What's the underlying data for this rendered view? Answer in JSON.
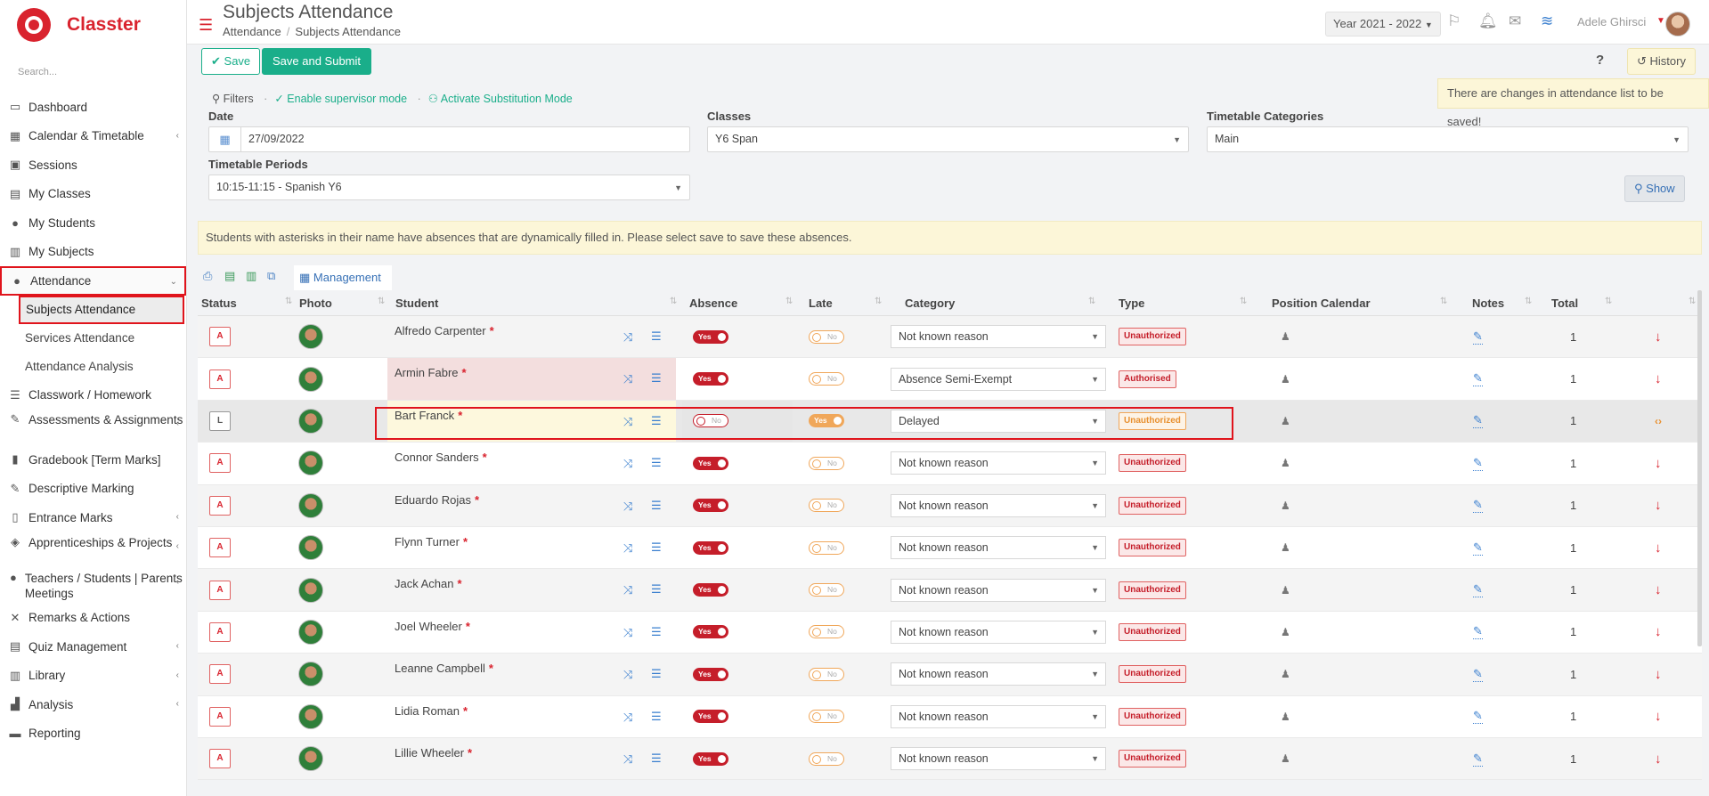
{
  "app": {
    "name": "Classter"
  },
  "sidebar": {
    "search_placeholder": "Search...",
    "items": [
      {
        "label": "Dashboard",
        "icon": "monitor-icon",
        "glyph": "▭"
      },
      {
        "label": "Calendar & Timetable",
        "icon": "calendar-icon",
        "glyph": "▦",
        "chevron": true
      },
      {
        "label": "Sessions",
        "icon": "sessions-icon",
        "glyph": "▣"
      },
      {
        "label": "My Classes",
        "icon": "classes-icon",
        "glyph": "▤"
      },
      {
        "label": "My Students",
        "icon": "students-icon",
        "glyph": "●"
      },
      {
        "label": "My Subjects",
        "icon": "book-icon",
        "glyph": "▥"
      },
      {
        "label": "Attendance",
        "icon": "attendance-icon",
        "glyph": "●",
        "chevron_down": true
      },
      {
        "label": "Classwork / Homework",
        "icon": "homework-icon",
        "glyph": "☰"
      },
      {
        "label": "Assessments & Assignments",
        "icon": "assessment-icon",
        "glyph": "✎",
        "chevron": true
      },
      {
        "label": "Gradebook [Term Marks]",
        "icon": "gradebook-icon",
        "glyph": "▮"
      },
      {
        "label": "Descriptive Marking",
        "icon": "marking-icon",
        "glyph": "✎"
      },
      {
        "label": "Entrance Marks",
        "icon": "entrance-icon",
        "glyph": "▯",
        "chevron": true
      },
      {
        "label": "Apprenticeships & Projects",
        "icon": "projects-icon",
        "glyph": "◈",
        "chevron": true
      },
      {
        "label": "Teachers / Students | Parents Meetings",
        "icon": "meetings-icon",
        "glyph": "●",
        "chevron": true
      },
      {
        "label": "Remarks & Actions",
        "icon": "remarks-icon",
        "glyph": "✕"
      },
      {
        "label": "Quiz Management",
        "icon": "quiz-icon",
        "glyph": "▤",
        "chevron": true
      },
      {
        "label": "Library",
        "icon": "library-icon",
        "glyph": "▥",
        "chevron": true
      },
      {
        "label": "Analysis",
        "icon": "analysis-icon",
        "glyph": "▟",
        "chevron": true
      },
      {
        "label": "Reporting",
        "icon": "print-icon",
        "glyph": "▬"
      }
    ],
    "attendance_sub": [
      "Subjects Attendance",
      "Services Attendance",
      "Attendance Analysis"
    ]
  },
  "header": {
    "title": "Subjects Attendance",
    "breadcrumb": [
      "Attendance",
      "Subjects Attendance"
    ],
    "year": "Year 2021 - 2022",
    "user": "Adele Ghirsci"
  },
  "toolbar": {
    "save": "Save",
    "save_submit": "Save and Submit",
    "help": "?",
    "history": "History",
    "changes_note": "There are changes in attendance list to be saved!"
  },
  "filters": {
    "label": "Filters",
    "supervisor": "Enable supervisor mode",
    "substitution": "Activate Substitution Mode",
    "date_label": "Date",
    "date_value": "27/09/2022",
    "classes_label": "Classes",
    "classes_value": "Y6 Span",
    "categories_label": "Timetable Categories",
    "categories_value": "Main",
    "periods_label": "Timetable Periods",
    "periods_value": "10:15-11:15 - Spanish Y6",
    "show": "Show"
  },
  "notice": "Students with asterisks in their name have absences that are dynamically filled in. Please select save to save these absences.",
  "table": {
    "management_tab": "Management",
    "headers": [
      "Status",
      "Photo",
      "Student",
      "Absence",
      "Late",
      "Category",
      "Type",
      "Position Calendar",
      "Notes",
      "Total"
    ],
    "rows": [
      {
        "status": "A",
        "name": "Alfredo Carpenter",
        "absence": "Yes",
        "late": "No",
        "category": "Not known reason",
        "type": "Unauthorized",
        "total": "1"
      },
      {
        "status": "A",
        "name": "Armin Fabre",
        "absence": "Yes",
        "late": "No",
        "category": "Absence Semi-Exempt",
        "type": "Authorised",
        "total": "1"
      },
      {
        "status": "L",
        "name": "Bart Franck",
        "absence": "No",
        "late": "Yes",
        "category": "Delayed",
        "type": "Unauthorized",
        "total": "1"
      },
      {
        "status": "A",
        "name": "Connor Sanders",
        "absence": "Yes",
        "late": "No",
        "category": "Not known reason",
        "type": "Unauthorized",
        "total": "1"
      },
      {
        "status": "A",
        "name": "Eduardo Rojas",
        "absence": "Yes",
        "late": "No",
        "category": "Not known reason",
        "type": "Unauthorized",
        "total": "1"
      },
      {
        "status": "A",
        "name": "Flynn Turner",
        "absence": "Yes",
        "late": "No",
        "category": "Not known reason",
        "type": "Unauthorized",
        "total": "1"
      },
      {
        "status": "A",
        "name": "Jack Achan",
        "absence": "Yes",
        "late": "No",
        "category": "Not known reason",
        "type": "Unauthorized",
        "total": "1"
      },
      {
        "status": "A",
        "name": "Joel Wheeler",
        "absence": "Yes",
        "late": "No",
        "category": "Not known reason",
        "type": "Unauthorized",
        "total": "1"
      },
      {
        "status": "A",
        "name": "Leanne Campbell",
        "absence": "Yes",
        "late": "No",
        "category": "Not known reason",
        "type": "Unauthorized",
        "total": "1"
      },
      {
        "status": "A",
        "name": "Lidia Roman",
        "absence": "Yes",
        "late": "No",
        "category": "Not known reason",
        "type": "Unauthorized",
        "total": "1"
      },
      {
        "status": "A",
        "name": "Lillie Wheeler",
        "absence": "Yes",
        "late": "No",
        "category": "Not known reason",
        "type": "Unauthorized",
        "total": "1"
      }
    ]
  },
  "colors": {
    "brand": "#d9232e",
    "accent": "#1aae8a",
    "link": "#3670b6",
    "highlight": "#e0141c"
  }
}
